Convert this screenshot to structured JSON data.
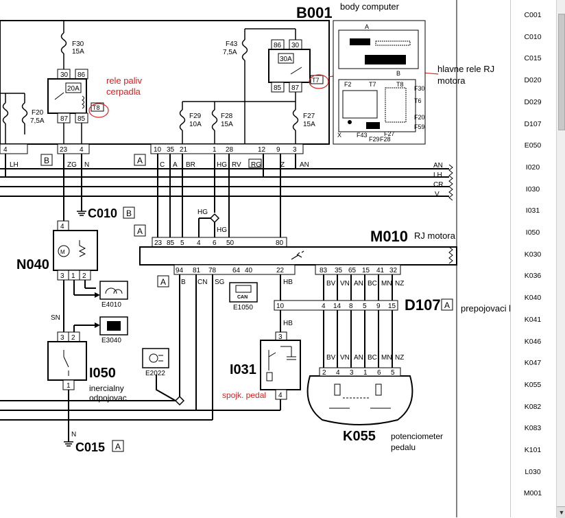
{
  "components": {
    "b001": {
      "code": "B001",
      "name": "body computer"
    },
    "m010": {
      "code": "M010",
      "name": "RJ motora"
    },
    "d107": {
      "code": "D107",
      "name": "prepojovaci kabel",
      "badge": "A"
    },
    "n040": {
      "code": "N040"
    },
    "i050": {
      "code": "I050",
      "name_line1": "inercialny",
      "name_line2": "odpojovac"
    },
    "i031": {
      "code": "I031",
      "name": "spojk. pedal"
    },
    "k055": {
      "code": "K055",
      "name_line1": "potenciometer",
      "name_line2": "pedalu"
    },
    "c010": {
      "code": "C010",
      "badge": "B"
    },
    "c015": {
      "code": "C015",
      "badge": "A"
    },
    "e4010": {
      "code": "E4010"
    },
    "e3040": {
      "code": "E3040"
    },
    "e2022": {
      "code": "E2022"
    },
    "e1050": {
      "code": "E1050",
      "inner": "CAN"
    }
  },
  "annotations": {
    "rele_paliv_1": "rele paliv",
    "rele_paliv_2": "cerpadla",
    "hlavne_rele_1": "hlavne rele RJ",
    "hlavne_rele_2": "motora"
  },
  "fuses": [
    {
      "id": "F30",
      "rating": "15A"
    },
    {
      "id": "F43",
      "rating": "7,5A"
    },
    {
      "id": "F20",
      "rating": "7,5A"
    },
    {
      "id": "F29",
      "rating": "10A"
    },
    {
      "id": "F28",
      "rating": "15A"
    },
    {
      "id": "F27",
      "rating": "15A"
    }
  ],
  "relays": {
    "fuel": {
      "rating": "20A",
      "pin_top_left": "30",
      "pin_top_right": "86",
      "pin_bot_left": "87",
      "pin_bot_right": "85",
      "tag": "T8"
    },
    "main": {
      "rating": "30A",
      "pin_top_left": "86",
      "pin_top_right": "30",
      "pin_bot_left": "85",
      "pin_bot_right": "87",
      "tag": "T7"
    }
  },
  "b001_pins": [
    "4",
    "23",
    "4",
    "10",
    "35",
    "21",
    "1",
    "28",
    "12",
    "9",
    "3"
  ],
  "b001_wires": [
    "LH",
    "ZG",
    "N",
    "C",
    "A",
    "BR",
    "HG",
    "RV",
    "RG",
    "Z",
    "AN"
  ],
  "bus_wires": [
    "AN",
    "LH",
    "CR",
    "V"
  ],
  "m010_top_pins": [
    "23",
    "85",
    "5",
    "4",
    "6",
    "50",
    "80"
  ],
  "m010_bottom_pins": [
    "94",
    "81",
    "78",
    "64",
    "40",
    "22",
    "83",
    "35",
    "65",
    "15",
    "41",
    "32"
  ],
  "m010_wires": [
    "B",
    "CN",
    "SG",
    "HB",
    "BV",
    "VN",
    "AN",
    "BC",
    "MN",
    "NZ"
  ],
  "d107_pins": [
    "10",
    "4",
    "14",
    "8",
    "5",
    "9",
    "15"
  ],
  "k055_pins": [
    "2",
    "4",
    "3",
    "1",
    "6",
    "5"
  ],
  "k055_wires": [
    "BV",
    "VN",
    "AN",
    "BC",
    "MN",
    "NZ"
  ],
  "i031_pins": {
    "top": "3",
    "bottom": "4",
    "wire": "HB"
  },
  "n040_pins": {
    "top": "4",
    "b1": "3",
    "b2": "1",
    "b3": "2"
  },
  "i050_pins": {
    "t1": "3",
    "t2": "2",
    "bottom": "1"
  },
  "misc_wires": {
    "hg": "HG",
    "sn": "SN",
    "n": "N"
  },
  "inset": {
    "a": "A",
    "b": "B",
    "f2": "F2",
    "t7": "T7",
    "t8": "T8",
    "f30": "F30",
    "t6": "T6",
    "f20": "F20",
    "f59": "F59",
    "f27": "F27",
    "f43": "F43",
    "f29": "F29",
    "f28": "F28",
    "x": "X"
  },
  "badges": {
    "b": "B",
    "a1": "A",
    "a2": "A",
    "a3": "A"
  },
  "sidebar": {
    "items": [
      "C001",
      "C010",
      "C015",
      "D020",
      "D029",
      "D107",
      "E050",
      "I020",
      "I030",
      "I031",
      "I050",
      "K030",
      "K036",
      "K040",
      "K041",
      "K046",
      "K047",
      "K055",
      "K082",
      "K083",
      "K101",
      "L030",
      "M001"
    ]
  },
  "colors": {
    "annotation_red": "#d42020",
    "wire": "#000000"
  }
}
